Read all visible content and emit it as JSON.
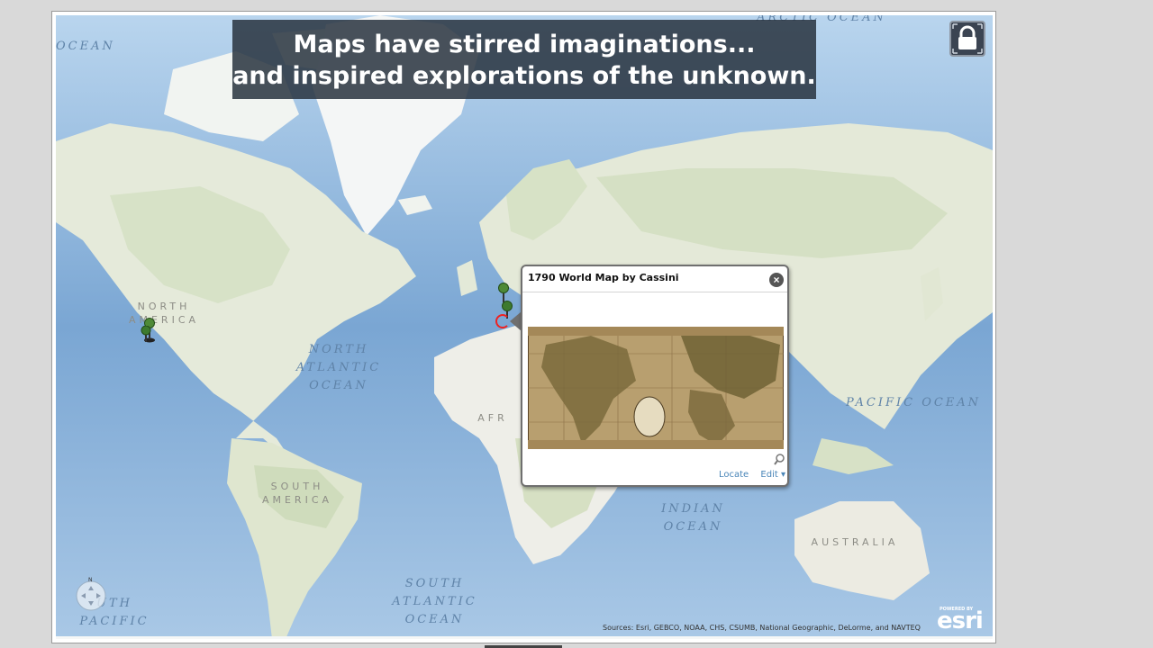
{
  "banner": {
    "line1": "Maps have stirred imaginations...",
    "line2": "and inspired explorations of the unknown."
  },
  "map": {
    "ocean_labels": [
      {
        "key": "north_atlantic",
        "text": "NORTH\nATLANTIC\nOCEAN"
      },
      {
        "key": "pacific_right",
        "text": "PACIFIC OCEAN"
      },
      {
        "key": "indian",
        "text": "INDIAN\nOCEAN"
      },
      {
        "key": "south_atlantic",
        "text": "SOUTH\nATLANTIC\nOCEAN"
      },
      {
        "key": "arctic",
        "text": "ARCTIC OCEAN"
      },
      {
        "key": "ocean_tl",
        "text": "OCEAN"
      },
      {
        "key": "south_pacific",
        "text": "UTH\nPACIFIC"
      }
    ],
    "land_labels": [
      {
        "key": "north_america",
        "text": "NORTH\nAMERICA"
      },
      {
        "key": "south_america",
        "text": "SOUTH\nAMERICA"
      },
      {
        "key": "africa",
        "text": "AFR"
      },
      {
        "key": "australia",
        "text": "AUSTRALIA"
      }
    ],
    "compass_letter": "N",
    "attribution": "Sources: Esri, GEBCO, NOAA, CHS, CSUMB, National Geographic, DeLorme, and NAVTEQ",
    "esri_powered": "POWERED BY",
    "esri_name": "esri"
  },
  "popup": {
    "title": "1790 World Map by Cassini",
    "close_symbol": "×",
    "locate_label": "Locate",
    "edit_label": "Edit ▾"
  },
  "icons": {
    "lock": "lock-icon",
    "close": "close-icon",
    "pin": "map-pin-icon",
    "zoom": "zoom-to-icon",
    "nav": "pan-navigation-icon"
  },
  "colors": {
    "ocean": "#9fc3e3",
    "land": "#e3e8d6",
    "banner_bg": "#28323e",
    "link": "#4a86b8",
    "pin": "#3d7a2e"
  }
}
